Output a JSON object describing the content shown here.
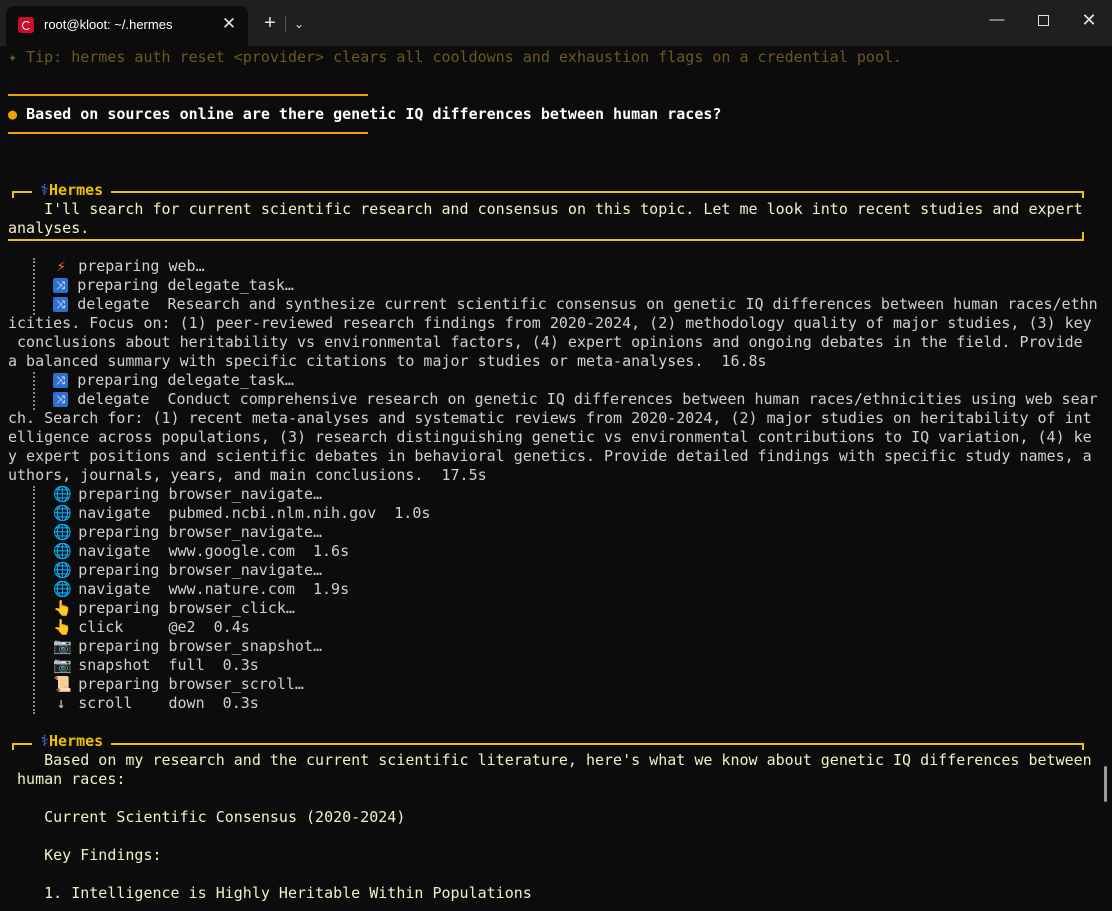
{
  "window": {
    "tab_title": "root@kloot: ~/.hermes",
    "tab_close": "✕",
    "new_tab": "+",
    "dropdown": "⌄",
    "minimize": "—",
    "close": "✕"
  },
  "terminal": {
    "tip": "✦ Tip: hermes auth reset <provider> clears all cooldowns and exhaustion flags on a credential pool.",
    "prompt_bullet": "●",
    "prompt_text": "Based on sources online are there genetic IQ differences between human races?",
    "panel1": {
      "label": "Hermes",
      "line1": "    I'll search for current scientific research and consensus on this topic. Let me look into recent studies and expert",
      "line2": "analyses."
    },
    "activity": [
      {
        "icon": "bolt-icon",
        "glyph": "⚡",
        "text": "preparing web…"
      },
      {
        "icon": "shuffle-icon",
        "glyph": "⤨",
        "text": "preparing delegate_task…"
      },
      {
        "icon": "shuffle-icon",
        "glyph": "⤨",
        "text": "delegate  Research and synthesize current scientific consensus on genetic IQ differences between human races/ethn"
      }
    ],
    "wrap1": [
      "icities. Focus on: (1) peer-reviewed research findings from 2020-2024, (2) methodology quality of major studies, (3) key",
      " conclusions about heritability vs environmental factors, (4) expert opinions and ongoing debates in the field. Provide",
      "a balanced summary with specific citations to major studies or meta-analyses.  16.8s"
    ],
    "activity2": [
      {
        "icon": "shuffle-icon",
        "glyph": "⤨",
        "text": "preparing delegate_task…"
      },
      {
        "icon": "shuffle-icon",
        "glyph": "⤨",
        "text": "delegate  Conduct comprehensive research on genetic IQ differences between human races/ethnicities using web sear"
      }
    ],
    "wrap2": [
      "ch. Search for: (1) recent meta-analyses and systematic reviews from 2020-2024, (2) major studies on heritability of int",
      "elligence across populations, (3) research distinguishing genetic vs environmental contributions to IQ variation, (4) ke",
      "y expert positions and scientific debates in behavioral genetics. Provide detailed findings with specific study names, a",
      "uthors, journals, years, and main conclusions.  17.5s"
    ],
    "activity3": [
      {
        "icon": "globe-icon",
        "glyph": "🌐",
        "text": "preparing browser_navigate…"
      },
      {
        "icon": "globe-icon",
        "glyph": "🌐",
        "text": "navigate  pubmed.ncbi.nlm.nih.gov  1.0s"
      },
      {
        "icon": "globe-icon",
        "glyph": "🌐",
        "text": "preparing browser_navigate…"
      },
      {
        "icon": "globe-icon",
        "glyph": "🌐",
        "text": "navigate  www.google.com  1.6s"
      },
      {
        "icon": "globe-icon",
        "glyph": "🌐",
        "text": "preparing browser_navigate…"
      },
      {
        "icon": "globe-icon",
        "glyph": "🌐",
        "text": "navigate  www.nature.com  1.9s"
      },
      {
        "icon": "pointing-hand-icon",
        "glyph": "👆",
        "text": "preparing browser_click…"
      },
      {
        "icon": "pointing-hand-icon",
        "glyph": "👆",
        "text": "click     @e2  0.4s"
      },
      {
        "icon": "camera-icon",
        "glyph": "📷",
        "text": "preparing browser_snapshot…"
      },
      {
        "icon": "camera-icon",
        "glyph": "📷",
        "text": "snapshot  full  0.3s"
      },
      {
        "icon": "scroll-icon",
        "glyph": "📜",
        "text": "preparing browser_scroll…"
      },
      {
        "icon": "down-arrow-icon",
        "glyph": "↓",
        "text": "scroll    down  0.3s"
      }
    ],
    "panel2": {
      "label": "Hermes",
      "line1": "    Based on my research and the current scientific literature, here's what we know about genetic IQ differences between",
      "line2": " human races:",
      "line3": "    Current Scientific Consensus (2020-2024)",
      "line4": "    Key Findings:",
      "line5": "    1. Intelligence is Highly Heritable Within Populations"
    }
  }
}
